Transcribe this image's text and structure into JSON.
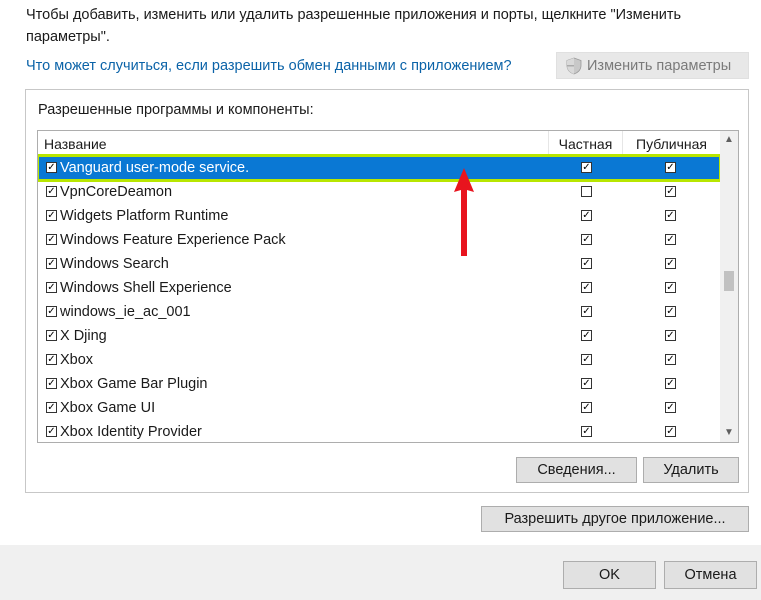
{
  "intro_text": "Чтобы добавить, изменить или удалить разрешенные приложения и порты, щелкните \"Изменить параметры\".",
  "risk_link": "Что может случиться, если разрешить обмен данными с приложением?",
  "change_settings_label": "Изменить параметры",
  "group_title": "Разрешенные программы и компоненты:",
  "columns": {
    "name": "Название",
    "private": "Частная",
    "public": "Публичная"
  },
  "rows": [
    {
      "name": "Vanguard user-mode service.",
      "enabled": true,
      "private": true,
      "public": true,
      "selected": true
    },
    {
      "name": "VpnCoreDeamon",
      "enabled": true,
      "private": false,
      "public": true
    },
    {
      "name": "Widgets Platform Runtime",
      "enabled": true,
      "private": true,
      "public": true
    },
    {
      "name": "Windows Feature Experience Pack",
      "enabled": true,
      "private": true,
      "public": true
    },
    {
      "name": "Windows Search",
      "enabled": true,
      "private": true,
      "public": true
    },
    {
      "name": "Windows Shell Experience",
      "enabled": true,
      "private": true,
      "public": true
    },
    {
      "name": "windows_ie_ac_001",
      "enabled": true,
      "private": true,
      "public": true
    },
    {
      "name": "X Djing",
      "enabled": true,
      "private": true,
      "public": true
    },
    {
      "name": "Xbox",
      "enabled": true,
      "private": true,
      "public": true
    },
    {
      "name": "Xbox Game Bar Plugin",
      "enabled": true,
      "private": true,
      "public": true
    },
    {
      "name": "Xbox Game UI",
      "enabled": true,
      "private": true,
      "public": true
    },
    {
      "name": "Xbox Identity Provider",
      "enabled": true,
      "private": true,
      "public": true
    }
  ],
  "details_label": "Сведения...",
  "delete_label": "Удалить",
  "allow_other_label": "Разрешить другое приложение...",
  "ok_label": "OK",
  "cancel_label": "Отмена",
  "colors": {
    "selection": "#0a78d4",
    "highlight_outline": "#b8e600",
    "annotation_arrow": "#e8141e",
    "link": "#0b63a8"
  }
}
